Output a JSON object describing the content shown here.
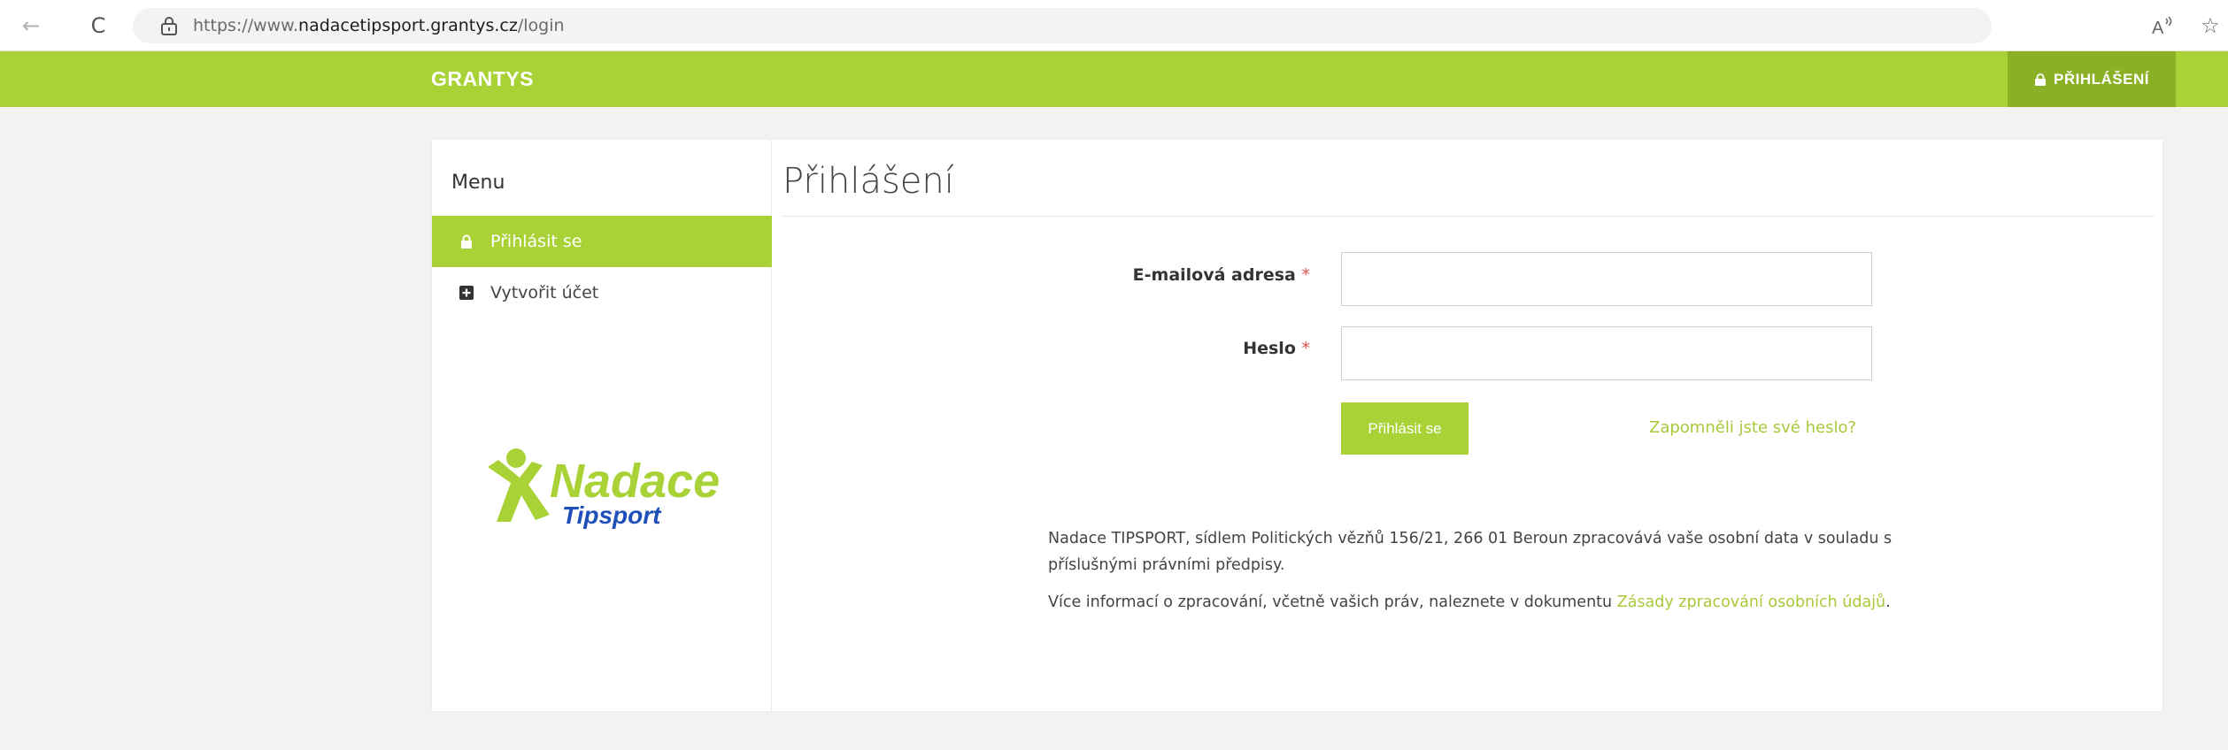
{
  "browser": {
    "url_prefix": "https://www.",
    "url_host": "nadacetipsport.grantys.cz",
    "url_path": "/login",
    "back_icon": "←",
    "reload_icon": "C",
    "favorite_icon": "☆"
  },
  "header": {
    "brand": "GRANTYS",
    "login_tab": "PŘIHLÁŠENÍ"
  },
  "sidebar": {
    "title": "Menu",
    "items": [
      {
        "label": "Přihlásit se",
        "active": true
      },
      {
        "label": "Vytvořit účet",
        "active": false
      }
    ],
    "logo": {
      "line1": "Nadace",
      "line2": "Tipsport"
    }
  },
  "main": {
    "title": "Přihlášení",
    "email_label": "E-mailová adresa",
    "password_label": "Heslo",
    "required_mark": "*",
    "submit_label": "Přihlásit se",
    "forgot_link": "Zapomněli jste své heslo?",
    "privacy_text_1": "Nadace TIPSPORT, sídlem Politických vězňů 156/21, 266 01 Beroun zpracovává vaše osobní data v souladu s příslušnými právními předpisy.",
    "privacy_text_2": "Více informací o zpracování, včetně vašich práv, naleznete v dokumentu",
    "privacy_link": "Zásady zpracování osobních údajů",
    "privacy_end": "."
  },
  "colors": {
    "brand_green": "#a9d236",
    "dark_green": "#8ab025",
    "link_green": "#a9c93a"
  }
}
